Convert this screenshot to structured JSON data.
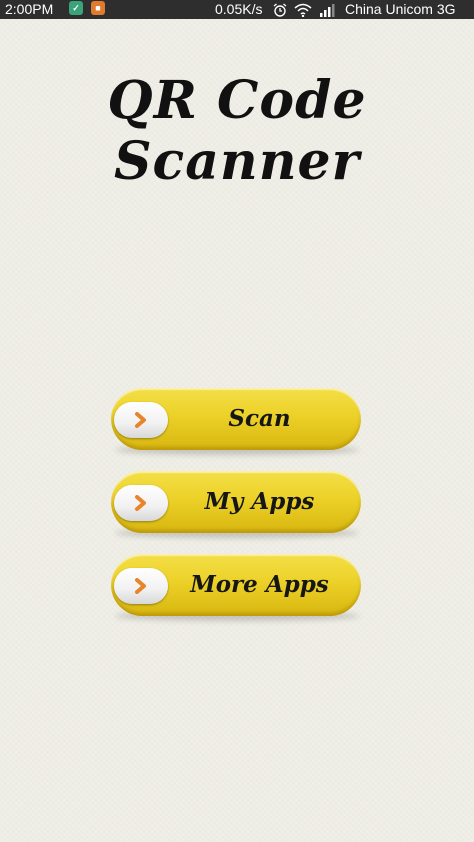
{
  "status_bar": {
    "time": "2:00PM",
    "speed": "0.05K/s",
    "carrier": "China Unicom 3G"
  },
  "app": {
    "title": "QR Code Scanner"
  },
  "buttons": [
    {
      "label": "Scan"
    },
    {
      "label": "My Apps"
    },
    {
      "label": "More Apps"
    }
  ],
  "colors": {
    "background": "#f1f0e8",
    "button_yellow": "#ecd128",
    "arrow_orange": "#e8842a",
    "status_bar": "#2e2e2e"
  },
  "icons": [
    "shield-notification-icon",
    "app-notification-icon",
    "alarm-icon",
    "wifi-icon",
    "signal-icon",
    "chevron-right-icon"
  ]
}
